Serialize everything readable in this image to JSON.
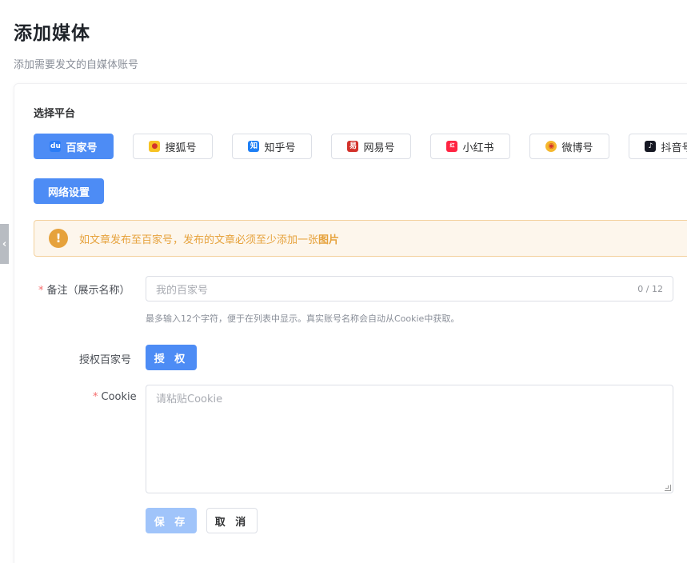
{
  "header": {
    "title": "添加媒体",
    "subtitle": "添加需要发文的自媒体账号"
  },
  "platform_section": {
    "label": "选择平台",
    "platforms": [
      {
        "label": "百家号",
        "icon": "baijiahao-icon",
        "active": true,
        "color": "#2b7cf6"
      },
      {
        "label": "搜狐号",
        "icon": "sohu-icon",
        "active": false,
        "color": "#f7c324"
      },
      {
        "label": "知乎号",
        "icon": "zhihu-icon",
        "active": false,
        "color": "#1e7ff5"
      },
      {
        "label": "网易号",
        "icon": "netease-icon",
        "active": false,
        "color": "#d3322b"
      },
      {
        "label": "小红书",
        "icon": "xiaohongshu-icon",
        "active": false,
        "color": "#ff2442"
      },
      {
        "label": "微博号",
        "icon": "weibo-icon",
        "active": false,
        "color": "#f5b82e"
      },
      {
        "label": "抖音号",
        "icon": "douyin-icon",
        "active": false,
        "color": "#161823"
      }
    ],
    "network_button": "网络设置"
  },
  "alert": {
    "icon": "warning-icon",
    "text": "如文章发布至百家号，发布的文章必须至少添加一张",
    "emphasis": "图片"
  },
  "form": {
    "remark": {
      "label": "备注（展示名称）",
      "placeholder": "我的百家号",
      "count": "0 / 12",
      "hint": "最多输入12个字符，便于在列表中显示。真实账号名称会自动从Cookie中获取。"
    },
    "auth": {
      "label": "授权百家号",
      "button": "授 权"
    },
    "cookie": {
      "label": "Cookie",
      "placeholder": "请粘贴Cookie"
    },
    "save_button": "保 存",
    "cancel_button": "取 消"
  },
  "side_toggle": "‹",
  "colors": {
    "primary": "#4d8cf5",
    "primary_disabled": "#a0c4fa",
    "warning": "#e6a23c",
    "required": "#f56c6c"
  }
}
